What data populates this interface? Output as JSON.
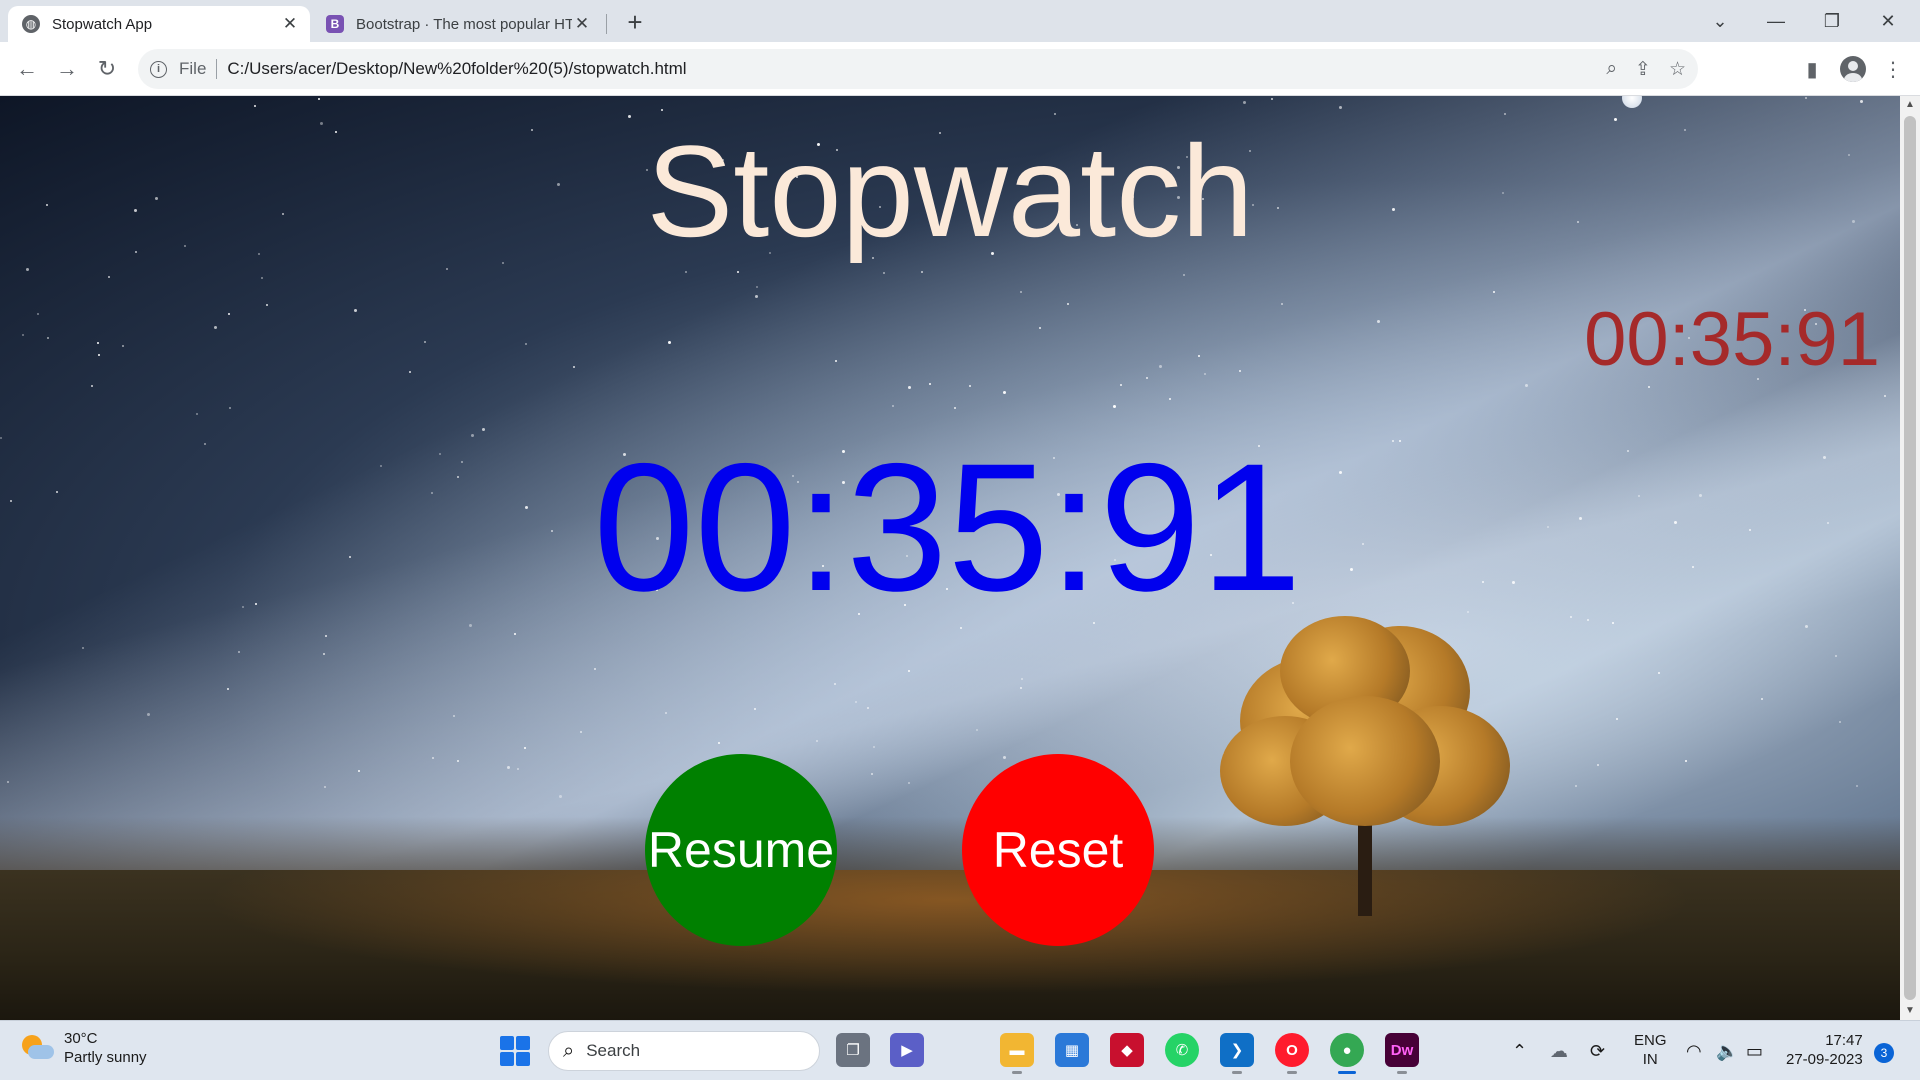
{
  "browser": {
    "tabs": [
      {
        "title": "Stopwatch App",
        "active": true,
        "icon": "globe-icon"
      },
      {
        "title": "Bootstrap · The most popular HTML",
        "active": false,
        "icon": "bootstrap-icon",
        "icon_letter": "B"
      }
    ],
    "address": {
      "scheme_label": "File",
      "url": "C:/Users/acer/Desktop/New%20folder%20(5)/stopwatch.html"
    }
  },
  "page": {
    "title": "Stopwatch",
    "mini_time": "00:35:91",
    "main_time": "00:35:91",
    "resume_label": "Resume",
    "reset_label": "Reset",
    "colors": {
      "title": "#fbe9d9",
      "mini_time": "#a52a2a",
      "main_time": "#0000ee",
      "resume_bg": "#008000",
      "reset_bg": "#ff0000"
    }
  },
  "taskbar": {
    "weather": {
      "temp": "30°C",
      "desc": "Partly sunny"
    },
    "search_placeholder": "Search",
    "apps": [
      {
        "name": "task-view-icon"
      },
      {
        "name": "teams-meet-icon"
      },
      {
        "name": "file-explorer-icon"
      },
      {
        "name": "microsoft-store-icon"
      },
      {
        "name": "cs-eagle-icon"
      },
      {
        "name": "whatsapp-icon"
      },
      {
        "name": "vscode-icon"
      },
      {
        "name": "opera-icon"
      },
      {
        "name": "chrome-icon"
      },
      {
        "name": "dreamweaver-icon",
        "label": "Dw"
      }
    ],
    "lang": {
      "line1": "ENG",
      "line2": "IN"
    },
    "clock": {
      "time": "17:47",
      "date": "27-09-2023"
    },
    "notifications": "3"
  }
}
